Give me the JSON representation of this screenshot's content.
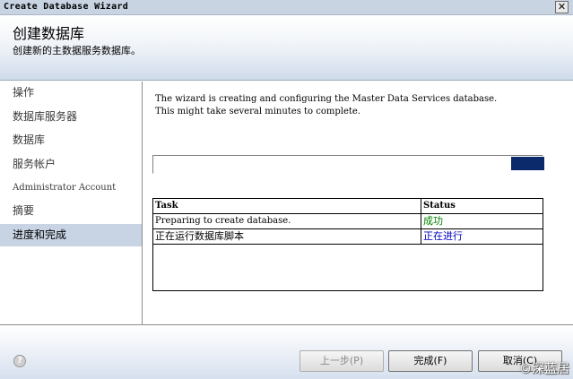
{
  "window": {
    "title": "Create Database Wizard",
    "close_glyph": "✕"
  },
  "header": {
    "title": "创建数据库",
    "subtitle": "创建新的主数据服务数据库。"
  },
  "nav": {
    "items": [
      {
        "label": "操作"
      },
      {
        "label": "数据库服务器"
      },
      {
        "label": "数据库"
      },
      {
        "label": "服务帐户"
      },
      {
        "label": "Administrator Account"
      },
      {
        "label": "摘要"
      },
      {
        "label": "进度和完成"
      }
    ],
    "selected_index": 6
  },
  "content": {
    "intro_line1": "The wizard is creating and configuring the Master Data Services database.",
    "intro_line2": "This might take several minutes to complete."
  },
  "table": {
    "headers": [
      "Task",
      "Status"
    ],
    "rows": [
      {
        "task": "Preparing to create database.",
        "status": "成功",
        "status_color": "#008000"
      },
      {
        "task": "正在运行数据库脚本",
        "status": "正在进行",
        "status_color": "#0000c0"
      }
    ]
  },
  "footer": {
    "help_icon": "help-icon",
    "back_label": "上一步(P)",
    "finish_label": "完成(F)",
    "cancel_label": "取消(C)",
    "watermark": "©深蓝居"
  },
  "colors": {
    "selected_nav_bg": "#c8d3e3",
    "progress_fill": "#0a2a6c",
    "success": "#008000",
    "in_progress": "#0000c0"
  }
}
